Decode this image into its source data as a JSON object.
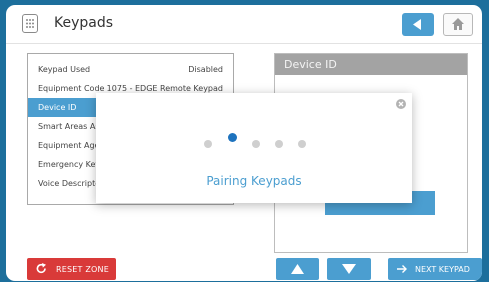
{
  "header": {
    "title": "Keypads",
    "icons": {
      "keypad": "keypad-icon",
      "back": "arrow-left-icon",
      "home": "home-icon"
    }
  },
  "info_panel": {
    "rows": [
      {
        "label": "Keypad Used",
        "value": "Disabled",
        "selected": false
      },
      {
        "label": "Equipment Code",
        "value": "1075 - EDGE Remote Keypad",
        "selected": false
      },
      {
        "label": "Device ID",
        "value": "",
        "selected": true
      },
      {
        "label": "Smart Areas Ass",
        "value": "",
        "selected": false
      },
      {
        "label": "Equipment Age",
        "value": "",
        "selected": false
      },
      {
        "label": "Emergency Key",
        "value": "",
        "selected": false
      },
      {
        "label": "Voice Descripto",
        "value": "",
        "selected": false
      }
    ]
  },
  "device_panel": {
    "title": "Device ID"
  },
  "modal": {
    "message": "Pairing Keypads",
    "dot_count": 5,
    "active_dot": 2,
    "close_icon": "close-icon"
  },
  "footer": {
    "reset_label": "RESET ZONE",
    "next_label": "NEXT KEYPAD",
    "icons": {
      "reset": "refresh-icon",
      "up": "arrow-up-icon",
      "down": "arrow-down-icon",
      "next": "arrow-right-icon"
    }
  },
  "colors": {
    "background": "#1d6f9c",
    "accent": "#4b9ed0",
    "danger": "#d93a39",
    "panel_header": "#a3a3a3",
    "spinner_active": "#1e73be"
  }
}
